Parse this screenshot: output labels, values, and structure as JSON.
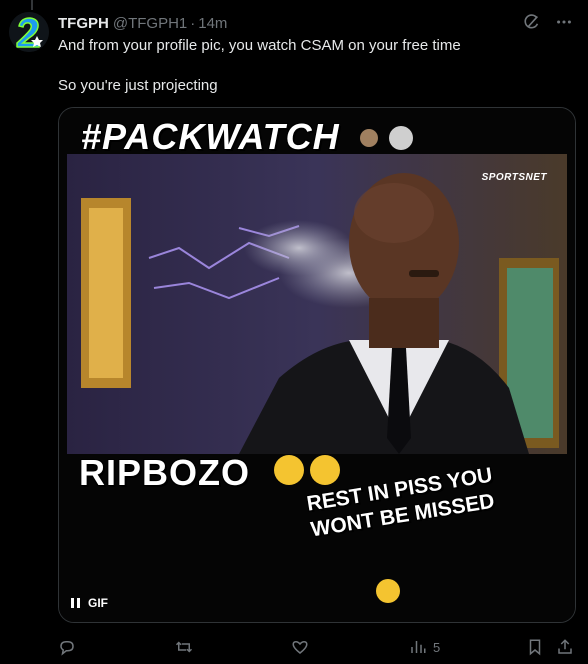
{
  "tweet": {
    "author_name": "TFGPH",
    "author_handle": "@TFGPH1",
    "separator": "·",
    "time": "14m",
    "paragraphs": [
      "And from your profile pic, you watch CSAM on your free time",
      "So you're just projecting"
    ]
  },
  "media": {
    "type_label": "GIF",
    "overlay_top": "#PACKWATCH",
    "overlay_middle": "RIPBOZO",
    "overlay_bottom_line1": "REST IN PISS YOU",
    "overlay_bottom_line2": "WONT BE MISSED",
    "watermark": "SPORTSNET"
  },
  "actions": {
    "reply_count": "",
    "retweet_count": "",
    "like_count": "",
    "views_count": "5"
  },
  "colors": {
    "background": "#000000",
    "text_primary": "#e7e9ea",
    "text_secondary": "#71767b",
    "border": "#2f3336"
  },
  "icons": [
    "grok-icon",
    "more-icon",
    "reply-icon",
    "retweet-icon",
    "like-icon",
    "views-icon",
    "bookmark-icon",
    "share-icon",
    "pause-icon"
  ]
}
